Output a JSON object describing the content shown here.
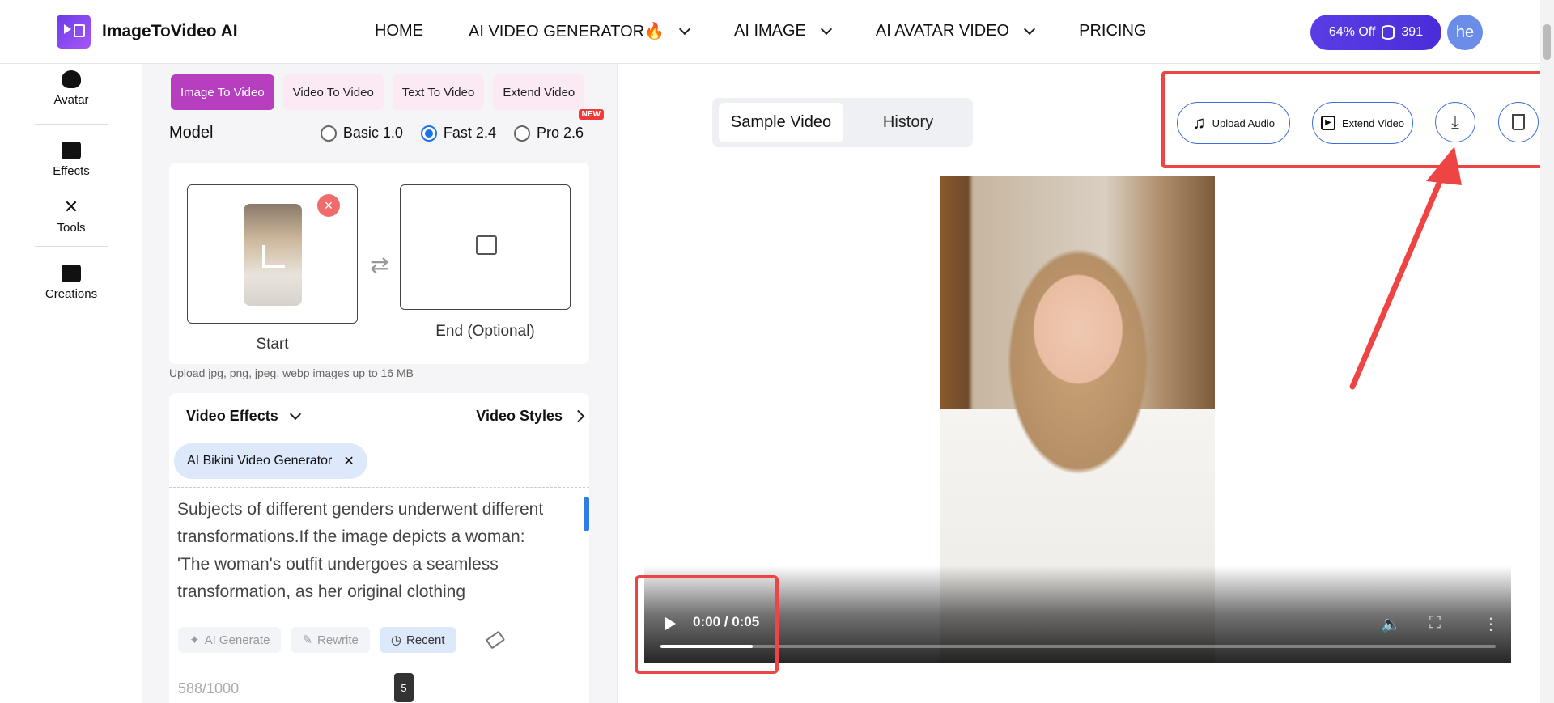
{
  "header": {
    "brand": "ImageToVideo AI",
    "nav": [
      {
        "label": "HOME",
        "dropdown": false
      },
      {
        "label": "AI VIDEO GENERATOR🔥",
        "dropdown": true
      },
      {
        "label": "AI IMAGE",
        "dropdown": true
      },
      {
        "label": "AI AVATAR VIDEO",
        "dropdown": true
      },
      {
        "label": "PRICING",
        "dropdown": false
      }
    ],
    "promo_label": "64% Off",
    "credits": "391",
    "avatar_initials": "he"
  },
  "sidebar": {
    "items": [
      {
        "label": "Avatar",
        "icon": "avatar-icon"
      },
      {
        "label": "Effects",
        "icon": "video-camera-icon"
      },
      {
        "label": "Tools",
        "icon": "tools-icon"
      },
      {
        "label": "Creations",
        "icon": "creations-icon"
      }
    ]
  },
  "panel": {
    "tabs": [
      {
        "label": "Image To Video",
        "active": true
      },
      {
        "label": "Video To Video",
        "active": false
      },
      {
        "label": "Text To Video",
        "active": false
      },
      {
        "label": "Extend Video",
        "active": false
      }
    ],
    "new_badge": "NEW",
    "model_label": "Model",
    "models": [
      {
        "label": "Basic 1.0",
        "selected": false
      },
      {
        "label": "Fast 2.4",
        "selected": true
      },
      {
        "label": "Pro 2.6",
        "selected": false
      }
    ],
    "start_label": "Start",
    "end_label": "End (Optional)",
    "remove_glyph": "×",
    "swap_glyph": "⇄",
    "upload_hint": "Upload jpg, png, jpeg, webp images up to 16 MB",
    "effects_label": "Video Effects",
    "styles_label": "Video Styles",
    "chip_label": "AI Bikini Video Generator",
    "chip_close": "✕",
    "prompt_text": "Subjects of different genders underwent different transformations.If the image depicts a woman: 'The woman's outfit undergoes a seamless transformation, as her original clothing",
    "tools": [
      {
        "label": "AI Generate",
        "icon": "magic-wand-icon"
      },
      {
        "label": "Rewrite",
        "icon": "pencil-icon"
      },
      {
        "label": "Recent",
        "icon": "clock-icon"
      }
    ],
    "counter": "588/1000",
    "tooltip_value": "5"
  },
  "preview": {
    "segment": {
      "active": "Sample Video",
      "other": "History"
    },
    "actions": [
      {
        "label": "Upload Audio",
        "icon": "music-note-icon"
      },
      {
        "label": "Extend Video",
        "icon": "video-play-icon"
      }
    ],
    "round_actions": [
      {
        "name": "download-button",
        "icon": "download-icon"
      },
      {
        "name": "delete-button",
        "icon": "trash-icon"
      }
    ],
    "video": {
      "time": "0:00 / 0:05",
      "progress": 0.11
    }
  },
  "colors": {
    "accent": "#b53fbf",
    "promo": "#5b3de6",
    "annotation": "#ef4444",
    "link": "#3b6fd6"
  }
}
